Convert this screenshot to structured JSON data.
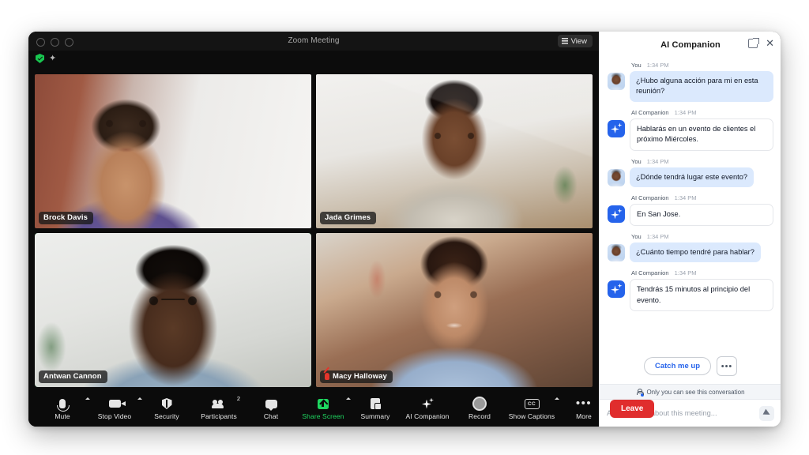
{
  "window": {
    "title": "Zoom Meeting",
    "view_button": {
      "label": "View",
      "icon": "grid-icon"
    },
    "status_icons": [
      {
        "name": "encryption-shield-icon",
        "color": "#18c750"
      },
      {
        "name": "pin-icon",
        "color": "#b7b7b7"
      }
    ]
  },
  "participants": [
    {
      "name": "Brock Davis",
      "active_speaker": false,
      "muted": false
    },
    {
      "name": "Jada Grimes",
      "active_speaker": false,
      "muted": false
    },
    {
      "name": "Antwan Cannon",
      "active_speaker": true,
      "muted": false
    },
    {
      "name": "Macy Halloway",
      "active_speaker": false,
      "muted": true
    }
  ],
  "toolbar": {
    "items": [
      {
        "label": "Mute",
        "icon": "microphone-icon",
        "caret": true,
        "badge": ""
      },
      {
        "label": "Stop Video",
        "icon": "camera-icon",
        "caret": true,
        "badge": ""
      },
      {
        "label": "Security",
        "icon": "shield-icon",
        "caret": false,
        "badge": ""
      },
      {
        "label": "Participants",
        "icon": "participants-icon",
        "caret": false,
        "badge": "2"
      },
      {
        "label": "Chat",
        "icon": "chat-bubble-icon",
        "caret": false,
        "badge": ""
      },
      {
        "label": "Share Screen",
        "icon": "share-screen-icon",
        "caret": true,
        "badge": ""
      },
      {
        "label": "Summary",
        "icon": "summary-document-icon",
        "caret": false,
        "badge": ""
      },
      {
        "label": "AI Companion",
        "icon": "sparkle-icon",
        "caret": false,
        "badge": ""
      },
      {
        "label": "Record",
        "icon": "record-circle-icon",
        "caret": false,
        "badge": ""
      },
      {
        "label": "Show Captions",
        "icon": "closed-captions-icon",
        "caret": true,
        "badge": ""
      },
      {
        "label": "More",
        "icon": "ellipsis-icon",
        "caret": false,
        "badge": ""
      }
    ],
    "leave_label": "Leave",
    "cc_glyph": "CC",
    "more_glyph": "•••",
    "accent_green": "#1ed760",
    "leave_red": "#e02d2d"
  },
  "panel": {
    "title": "AI Companion",
    "popout_icon": "popout-icon",
    "close_icon": "close-icon",
    "messages": [
      {
        "author": "You",
        "time": "1:34 PM",
        "role": "user",
        "text": "¿Hubo alguna acción para mi en esta reunión?"
      },
      {
        "author": "AI Companion",
        "time": "1:34 PM",
        "role": "ai",
        "text": "Hablarás en un evento de clientes el próximo Miércoles."
      },
      {
        "author": "You",
        "time": "1:34 PM",
        "role": "user",
        "text": "¿Dónde tendrá lugar este evento?"
      },
      {
        "author": "AI Companion",
        "time": "1:34 PM",
        "role": "ai",
        "text": "En San Jose."
      },
      {
        "author": "You",
        "time": "1:34 PM",
        "role": "user",
        "text": "¿Cuánto tiempo tendré para hablar?"
      },
      {
        "author": "AI Companion",
        "time": "1:34 PM",
        "role": "ai",
        "text": "Tendrás 15 minutos al principio del evento."
      }
    ],
    "catch_me_up": "Catch me up",
    "overflow_glyph": "•••",
    "privacy_note": "Only you can see this conversation",
    "composer_placeholder": "Ask anything about this meeting...",
    "send_icon": "send-icon",
    "accent_blue": "#2563eb"
  }
}
